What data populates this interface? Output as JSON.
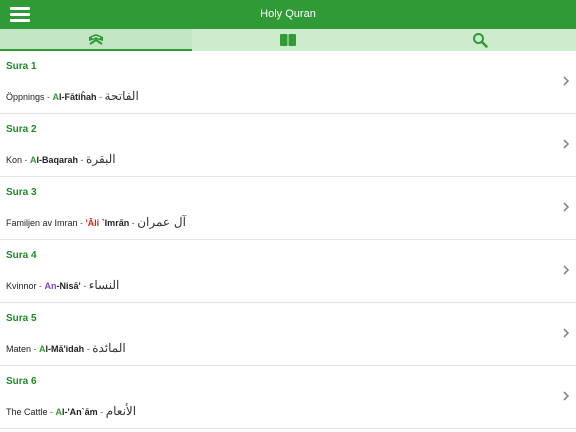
{
  "app": {
    "title": "Holy Quran"
  },
  "icons": {
    "menu": "hamburger-icon",
    "tab1": "quran-book-stand-icon",
    "tab2": "open-book-icon",
    "tab3": "search-icon",
    "row": "chevron-right-icon"
  },
  "colors": {
    "brand": "#2f9a36",
    "tab_bg": "#cdeccd",
    "sura_label": "#1f8a27",
    "red": "#e0261b"
  },
  "suras": [
    {
      "label": "Sura 1",
      "meaning": "Öppnings",
      "tr_a": "A",
      "tr_b": "l-Fātiĥah",
      "arabic": "الفاتحة"
    },
    {
      "label": "Sura 2",
      "meaning": "Kon",
      "tr_a": "A",
      "tr_b": "l-Baqarah",
      "arabic": "البقرة"
    },
    {
      "label": "Sura 3",
      "meaning": "Familjen av Imran",
      "tr_a": "'Āli",
      "tr_b": " `Imrān",
      "arabic": "آل عمران"
    },
    {
      "label": "Sura 4",
      "meaning": "Kvinnor",
      "tr_a": "An",
      "tr_b": "-Nisā'",
      "arabic": "النساء"
    },
    {
      "label": "Sura 5",
      "meaning": "Maten",
      "tr_a": "A",
      "tr_b": "l-Mā'idah",
      "arabic": "المائدة"
    },
    {
      "label": "Sura 6",
      "meaning": "The Cattle",
      "tr_a": "A",
      "tr_b": "l-'An`ām",
      "arabic": "الأنعام"
    }
  ]
}
